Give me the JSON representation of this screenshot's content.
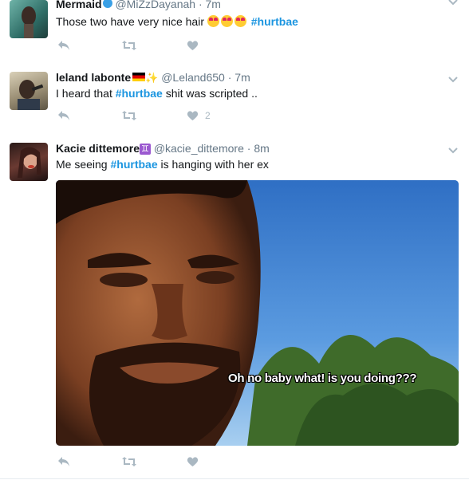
{
  "tweets": [
    {
      "name": "Mermaid",
      "handle": "@MiZzDayanah",
      "time": "7m",
      "text_before": "Those two have very nice hair",
      "hashtag": "#hurtbae",
      "text_after": "",
      "like_count": ""
    },
    {
      "name": "leland labonte",
      "handle": "@Leland650",
      "time": "7m",
      "text_before": "I heard that",
      "hashtag": "#hurtbae",
      "text_after": "shit was scripted ..",
      "like_count": "2"
    },
    {
      "name": "Kacie dittemore",
      "badge": "♊",
      "handle": "@kacie_dittemore",
      "time": "8m",
      "text_before": "Me seeing",
      "hashtag": "#hurtbae",
      "text_after": "is hanging with her ex",
      "like_count": "",
      "media_caption": "Oh no baby what! is you doing???"
    }
  ],
  "separator": "·",
  "icons": {
    "reply": "reply-icon",
    "retweet": "retweet-icon",
    "like": "heart-icon",
    "caret": "chevron-down-icon"
  },
  "colors": {
    "hashtag": "#1b95e0",
    "action": "#aab8c2",
    "meta": "#657786"
  }
}
